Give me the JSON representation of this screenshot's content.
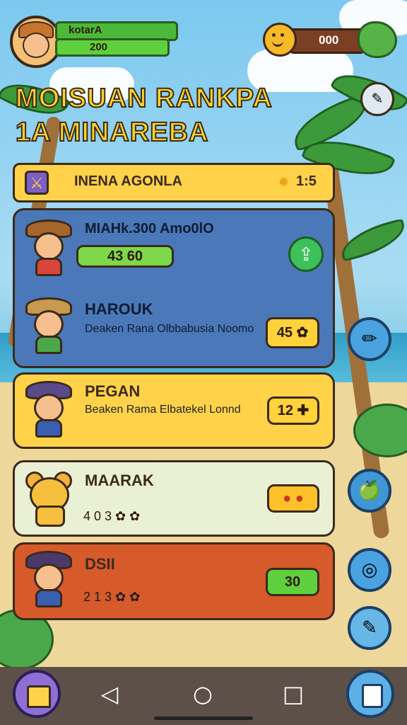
{
  "hud": {
    "player_name": "kotarA",
    "xp_value": "200",
    "coins": "000"
  },
  "title": {
    "line1": "MOISUAN RANKPA",
    "line2": "1A MINAREBA"
  },
  "leaderboard_header": {
    "label": "INENA AGONLA",
    "score": "1:5"
  },
  "entries": [
    {
      "name": "MIAHk.300 Amo0lO",
      "subtitle": "",
      "badge": "43 60",
      "badge_color": "#7dd84a",
      "card_color": "#4b78b8"
    },
    {
      "name": "HAROUK",
      "subtitle": "Deaken Rana Olbbabusia Noomo",
      "badge": "45 ✿",
      "badge_color": "#ffd13a",
      "card_color": "#4b78b8"
    },
    {
      "name": "PEGAN",
      "subtitle": "Beaken Rama Elbatekel Lonnd",
      "badge": "12 ✚",
      "badge_color": "#ffd13a",
      "card_color": "#ffd24a"
    },
    {
      "name": "MAARAK",
      "subtitle": "4 0 3 ✿ ✿",
      "badge": "● ●",
      "badge_color": "#ffc12a",
      "card_color": "#eaf0d3"
    },
    {
      "name": "DSII",
      "subtitle": "2 1 3 ✿ ✿",
      "badge": "30",
      "badge_color": "#5fcf3e",
      "card_color": "#d65a2a"
    }
  ],
  "icons": {
    "avatar": "explorer-avatar-icon",
    "coin": "smiley-coin-icon",
    "gem": "green-gem-icon",
    "chat": "chat-bubble-icon",
    "header": "sword-icon",
    "share": "share-icon",
    "edit": "brush-icon",
    "fruit": "apple-icon",
    "compass": "compass-icon",
    "note": "notepad-icon",
    "home": "home-icon",
    "calc": "calculator-icon"
  },
  "nav": {
    "back": "◁",
    "home": "○",
    "recent": "□"
  }
}
